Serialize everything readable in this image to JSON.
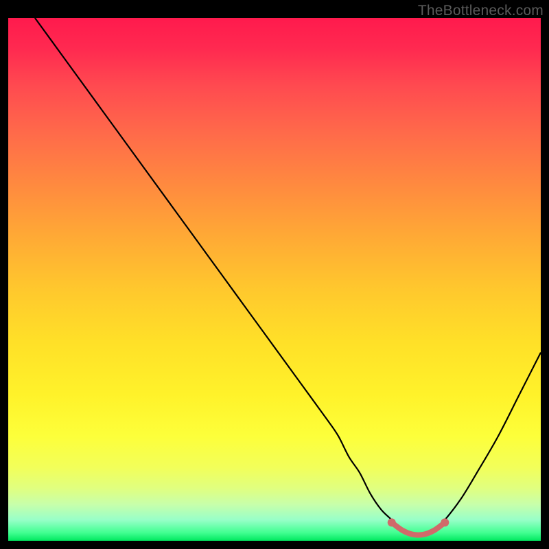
{
  "watermark": "TheBottleneck.com",
  "chart_data": {
    "type": "line",
    "title": "",
    "xlabel": "",
    "ylabel": "",
    "xlim": [
      0,
      100
    ],
    "ylim": [
      0,
      100
    ],
    "grid": false,
    "gradient": {
      "top_color": "#ff1a4d",
      "mid_color": "#ffe028",
      "bottom_color": "#00e860"
    },
    "series": [
      {
        "name": "bottleneck-curve",
        "color": "#000000",
        "x": [
          5,
          10,
          15,
          20,
          25,
          30,
          35,
          40,
          45,
          50,
          55,
          60,
          62,
          64,
          66,
          68,
          70,
          72,
          74,
          76,
          78,
          80,
          82,
          85,
          88,
          92,
          96,
          100
        ],
        "y": [
          100,
          93,
          86,
          79,
          72,
          65,
          58,
          51,
          44,
          37,
          30,
          23,
          20,
          16,
          13,
          9,
          6,
          4,
          2,
          1,
          1,
          2,
          4,
          8,
          13,
          20,
          28,
          36
        ]
      },
      {
        "name": "optimal-band",
        "color": "#d06a6a",
        "x": [
          72,
          74,
          76,
          78,
          80,
          82
        ],
        "y": [
          3.5,
          2.0,
          1.2,
          1.2,
          2.0,
          3.5
        ]
      }
    ],
    "markers": [
      {
        "name": "optimal-start",
        "x": 72,
        "y": 3.5,
        "color": "#d06a6a"
      },
      {
        "name": "optimal-end",
        "x": 82,
        "y": 3.5,
        "color": "#d06a6a"
      }
    ]
  }
}
